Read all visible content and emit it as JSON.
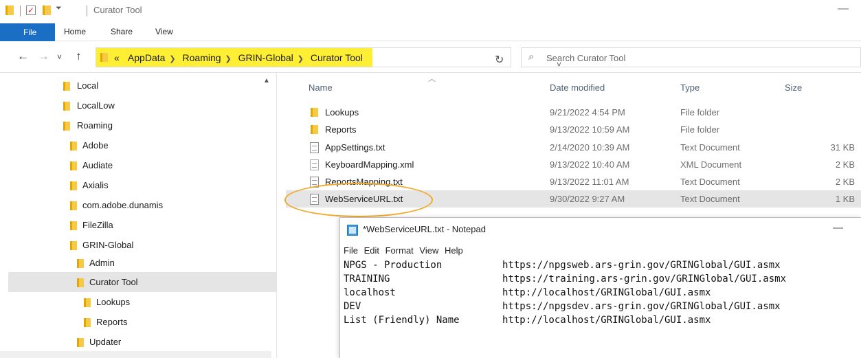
{
  "window": {
    "title": "Curator Tool",
    "minimize_glyph": "—"
  },
  "ribbon": {
    "tabs": [
      "File",
      "Home",
      "Share",
      "View"
    ]
  },
  "nav": {
    "back": "←",
    "forward": "→",
    "recent": "˅",
    "up": "↑"
  },
  "address": {
    "prefix": "«",
    "crumbs": [
      "AppData",
      "Roaming",
      "GRIN-Global",
      "Curator Tool"
    ],
    "highlight_color": "#ffef34",
    "dropdown": "˅",
    "refresh": "↻"
  },
  "search": {
    "placeholder": "Search Curator Tool"
  },
  "navpane": {
    "items": [
      {
        "label": "Local",
        "level": 0
      },
      {
        "label": "LocalLow",
        "level": 0
      },
      {
        "label": "Roaming",
        "level": 0
      },
      {
        "label": "Adobe",
        "level": 1
      },
      {
        "label": "Audiate",
        "level": 1
      },
      {
        "label": "Axialis",
        "level": 1
      },
      {
        "label": "com.adobe.dunamis",
        "level": 1
      },
      {
        "label": "FileZilla",
        "level": 1
      },
      {
        "label": "GRIN-Global",
        "level": 1
      },
      {
        "label": "Admin",
        "level": 2
      },
      {
        "label": "Curator Tool",
        "level": 2,
        "selected": true
      },
      {
        "label": "Lookups",
        "level": 3
      },
      {
        "label": "Reports",
        "level": 3
      },
      {
        "label": "Updater",
        "level": 2
      }
    ]
  },
  "filelist": {
    "columns": {
      "name": "Name",
      "date": "Date modified",
      "type": "Type",
      "size": "Size"
    },
    "rows": [
      {
        "name": "Lookups",
        "date": "9/21/2022 4:54 PM",
        "type": "File folder",
        "size": "",
        "icon": "folder-icon"
      },
      {
        "name": "Reports",
        "date": "9/13/2022 10:59 AM",
        "type": "File folder",
        "size": "",
        "icon": "folder-icon"
      },
      {
        "name": "AppSettings.txt",
        "date": "2/14/2020 10:39 AM",
        "type": "Text Document",
        "size": "31 KB",
        "icon": "text-file-icon"
      },
      {
        "name": "KeyboardMapping.xml",
        "date": "9/13/2022 10:40 AM",
        "type": "XML Document",
        "size": "2 KB",
        "icon": "xml-file-icon"
      },
      {
        "name": "ReportsMapping.txt",
        "date": "9/13/2022 11:01 AM",
        "type": "Text Document",
        "size": "2 KB",
        "icon": "text-file-icon"
      },
      {
        "name": "WebServiceURL.txt",
        "date": "9/30/2022 9:27 AM",
        "type": "Text Document",
        "size": "1 KB",
        "icon": "text-file-icon",
        "selected": true
      }
    ],
    "callout_color": "#f0a92a"
  },
  "notepad": {
    "title": "*WebServiceURL.txt - Notepad",
    "minimize_glyph": "—",
    "menu": [
      "File",
      "Edit",
      "Format",
      "View",
      "Help"
    ],
    "lines": [
      {
        "key": "NPGS - Production",
        "value": "https://npgsweb.ars-grin.gov/GRINGlobal/GUI.asmx"
      },
      {
        "key": "TRAINING",
        "value": "https://training.ars-grin.gov/GRINGlobal/GUI.asmx"
      },
      {
        "key": "localhost",
        "value": "http://localhost/GRINGlobal/GUI.asmx"
      },
      {
        "key": "DEV",
        "value": "https://npgsdev.ars-grin.gov/GRINGlobal/GUI.asmx"
      },
      {
        "key": "List (Friendly) Name",
        "value": "http://localhost/GRINGlobal/GUI.asmx"
      }
    ]
  }
}
